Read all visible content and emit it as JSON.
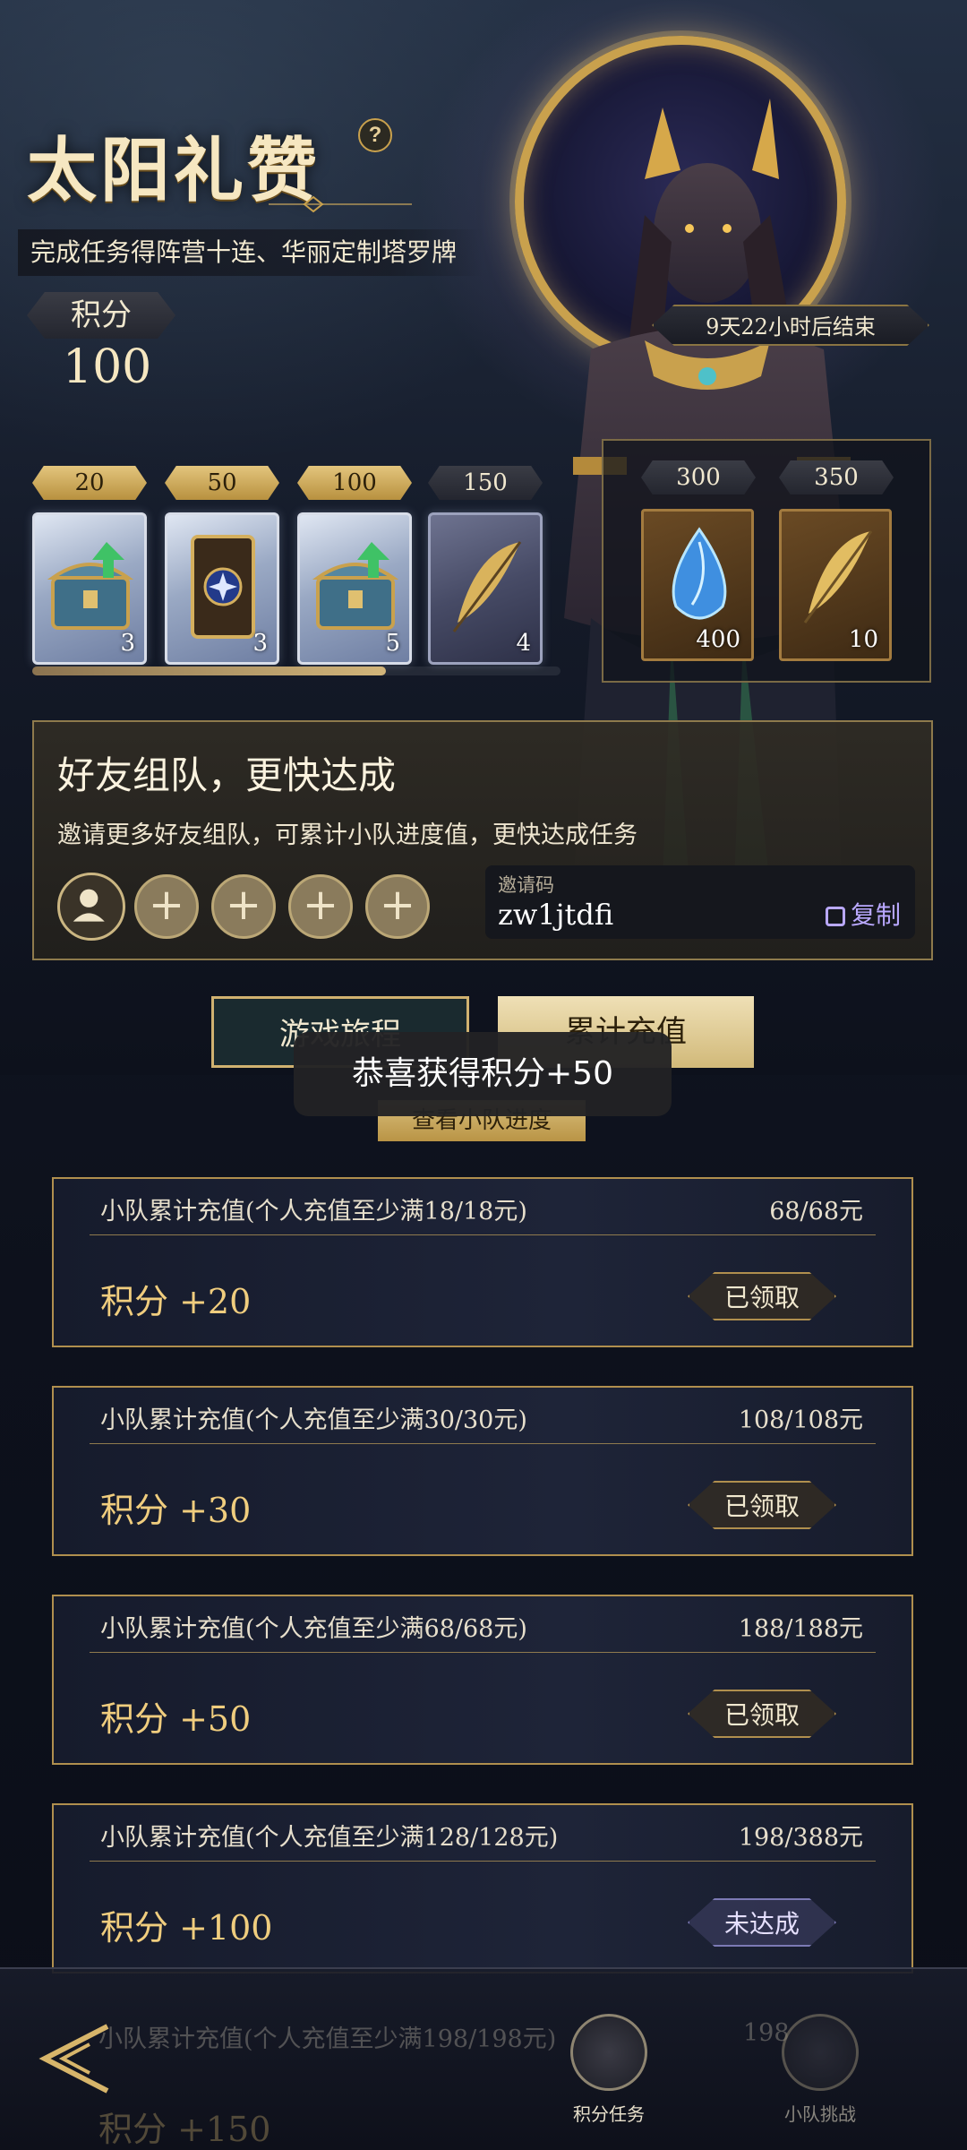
{
  "header": {
    "title": "太阳礼赞",
    "help_icon": "?",
    "subtitle_prefix": "完成任务得",
    "subtitle_highlight": "阵营十连、华丽定制塔罗牌",
    "score_label": "积分",
    "score_value": "100",
    "timer": "9天22小时后结束"
  },
  "rewards": {
    "milestones": [
      {
        "points": "20",
        "icon": "treasure-chest-icon",
        "qty": "3",
        "claimed": true
      },
      {
        "points": "50",
        "icon": "tarot-card-icon",
        "qty": "3",
        "claimed": true
      },
      {
        "points": "100",
        "icon": "treasure-chest-icon",
        "qty": "5",
        "claimed": true
      },
      {
        "points": "150",
        "icon": "golden-feather-icon",
        "qty": "4",
        "claimed": false
      }
    ],
    "progress_fraction": 0.67,
    "bonus": [
      {
        "points": "300",
        "icon": "blue-crystal-icon",
        "qty": "400"
      },
      {
        "points": "350",
        "icon": "golden-feather-icon",
        "qty": "10"
      }
    ]
  },
  "team": {
    "title": "好友组队，更快达成",
    "description": "邀请更多好友组队，可累计小队进度值，更快达成任务",
    "invite_label": "邀请码",
    "invite_code": "zw1jtdfi",
    "copy_label": "复制",
    "slot_icon": "+"
  },
  "tabs": {
    "journey": "游戏旅程",
    "recharge": "累计充值",
    "check_progress": "查看小队进度"
  },
  "toast": "恭喜获得积分+50",
  "tasks": [
    {
      "title": "小队累计充值(个人充值至少满18/18元)",
      "progress": "68/68元",
      "reward": "积分 +20",
      "status": "已领取"
    },
    {
      "title": "小队累计充值(个人充值至少满30/30元)",
      "progress": "108/108元",
      "reward": "积分 +30",
      "status": "已领取"
    },
    {
      "title": "小队累计充值(个人充值至少满68/68元)",
      "progress": "188/188元",
      "reward": "积分 +50",
      "status": "已领取"
    },
    {
      "title": "小队累计充值(个人充值至少满128/128元)",
      "progress": "198/388元",
      "reward": "积分 +100",
      "status": "未达成"
    }
  ],
  "partial_task": {
    "title": "小队累计充值(个人充值至少满198/198元)",
    "progress": "198",
    "reward": "积分 +150"
  },
  "bottom_nav": {
    "items": [
      {
        "label": "积分任务",
        "icon": "coin-stack-icon",
        "active": true
      },
      {
        "label": "小队挑战",
        "icon": "team-icon",
        "active": false
      }
    ]
  }
}
